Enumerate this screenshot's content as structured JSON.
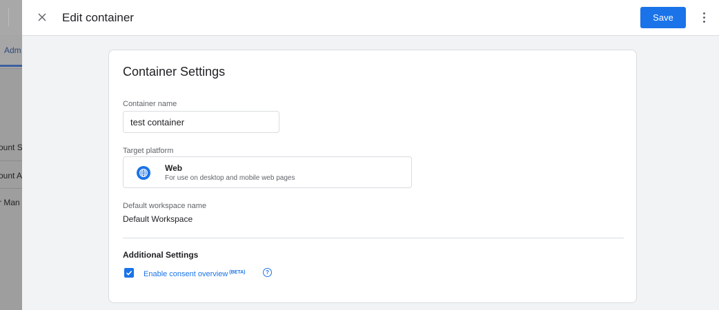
{
  "background": {
    "tab_label": "Adm",
    "items": [
      "ount S",
      "ount A",
      "r Man"
    ]
  },
  "header": {
    "title": "Edit container",
    "save_label": "Save"
  },
  "card": {
    "title": "Container Settings",
    "container_name": {
      "label": "Container name",
      "value": "test container"
    },
    "target_platform": {
      "label": "Target platform",
      "name": "Web",
      "description": "For use on desktop and mobile web pages"
    },
    "workspace": {
      "label": "Default workspace name",
      "value": "Default Workspace"
    },
    "additional": {
      "heading": "Additional Settings",
      "consent_label": "Enable consent overview",
      "beta_tag": "(BETA)",
      "help_glyph": "?",
      "checked": true
    }
  },
  "colors": {
    "accent": "#1a73e8",
    "panel_bg": "#f1f3f4",
    "border": "#dadce0"
  },
  "icons": [
    "close-icon",
    "more-vert-icon",
    "globe-icon",
    "check-icon",
    "help-icon"
  ]
}
